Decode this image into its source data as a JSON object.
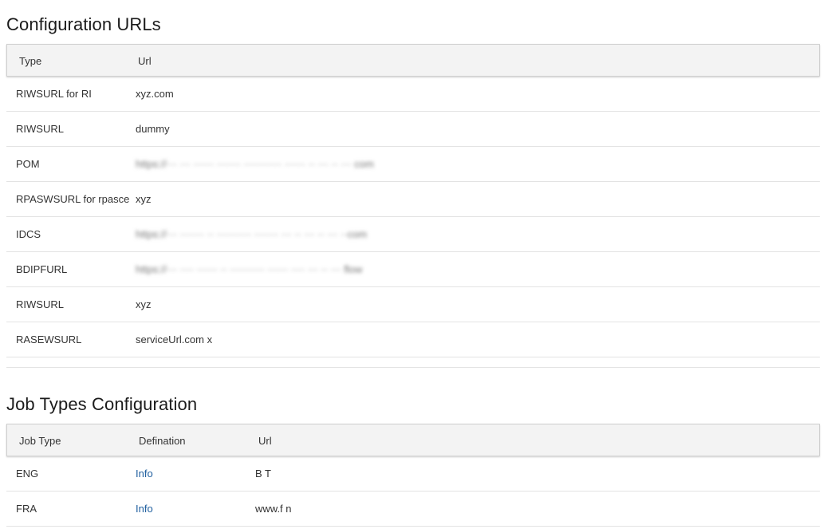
{
  "config_section": {
    "title": "Configuration URLs",
    "columns": {
      "type": "Type",
      "url": "Url"
    },
    "rows": [
      {
        "type": "RIWSURL for RI",
        "url": "xyz.com",
        "blurred": false
      },
      {
        "type": "RIWSURL",
        "url": "dummy",
        "blurred": false
      },
      {
        "type": "POM",
        "url": "https://··· ··· ······ ······· ··········· ······ ·· ···  ·· ··· com",
        "blurred": true
      },
      {
        "type": "RPASWSURL for rpasce",
        "url": "xyz",
        "blurred": false
      },
      {
        "type": "IDCS",
        "url": "https://··· ······· ·· ·········· ······· ··· ·· ··· ·· ··· ··com",
        "blurred": true
      },
      {
        "type": "BDIPFURL",
        "url": "https://··· ···· ······ ·· ·········· ······ ···· ··· ·· ··· flow",
        "blurred": true
      },
      {
        "type": "RIWSURL",
        "url": "xyz",
        "blurred": false
      },
      {
        "type": "RASEWSURL",
        "url": "serviceUrl.com x",
        "blurred": false
      }
    ]
  },
  "job_section": {
    "title": "Job Types Configuration",
    "columns": {
      "job_type": "Job Type",
      "definition": "Defination",
      "url": "Url"
    },
    "rows": [
      {
        "job_type": "ENG",
        "definition": "Info",
        "url": "B   T"
      },
      {
        "job_type": "FRA",
        "definition": "Info",
        "url": "www.f      n"
      }
    ]
  },
  "colors": {
    "link": "#1f5f9f",
    "header_bg": "#f3f3f3",
    "row_divider": "#e3e3e3"
  }
}
